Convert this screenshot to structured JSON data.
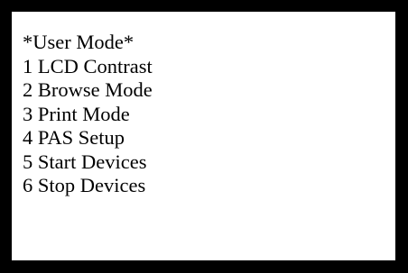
{
  "display": {
    "title": "*User Mode*",
    "items": [
      {
        "label": "1 LCD Contrast"
      },
      {
        "label": "2 Browse Mode"
      },
      {
        "label": "3 Print Mode"
      },
      {
        "label": "4 PAS Setup"
      },
      {
        "label": "5 Start Devices"
      },
      {
        "label": "6 Stop Devices"
      }
    ]
  },
  "colors": {
    "bezel": "#000000",
    "screen_background": "#ffffff",
    "text": "#000000"
  }
}
